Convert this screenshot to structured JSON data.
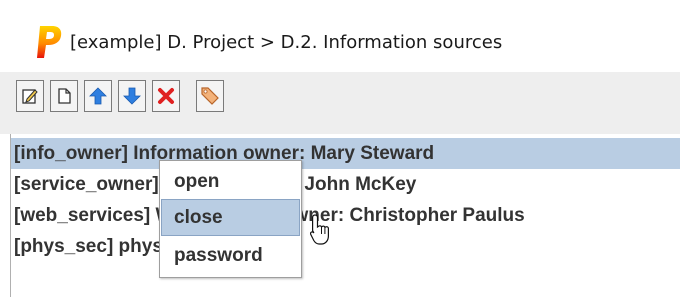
{
  "window": {
    "title": "[example] D. Project > D.2. Information sources",
    "logo_letter": "P"
  },
  "toolbar": {
    "buttons": [
      {
        "name": "edit",
        "icon": "edit-icon"
      },
      {
        "name": "new",
        "icon": "new-document-icon"
      },
      {
        "name": "move-up",
        "icon": "arrow-up-icon"
      },
      {
        "name": "move-down",
        "icon": "arrow-down-icon"
      },
      {
        "name": "delete",
        "icon": "delete-icon"
      },
      {
        "name": "tag",
        "icon": "tag-icon"
      }
    ]
  },
  "list": {
    "rows": [
      {
        "label": "[info_owner] Information owner: Mary Steward",
        "selected": true
      },
      {
        "label": "[service_owner] Service owner: John McKey",
        "selected": false
      },
      {
        "label": "[web_services] Web services owner: Christopher Paulus",
        "selected": false
      },
      {
        "label": "[phys_sec] physical security",
        "selected": false
      }
    ]
  },
  "context_menu": {
    "items": [
      {
        "label": "open",
        "hovered": false
      },
      {
        "label": "close",
        "hovered": true
      },
      {
        "label": "password",
        "hovered": false
      }
    ]
  },
  "colors": {
    "selection": "#b9cde3",
    "logo_gradient_top": "#ffd400",
    "logo_gradient_bottom": "#e8140a",
    "arrow_blue": "#2f7fe0",
    "delete_red": "#e02020",
    "tag_orange": "#e8903a"
  }
}
